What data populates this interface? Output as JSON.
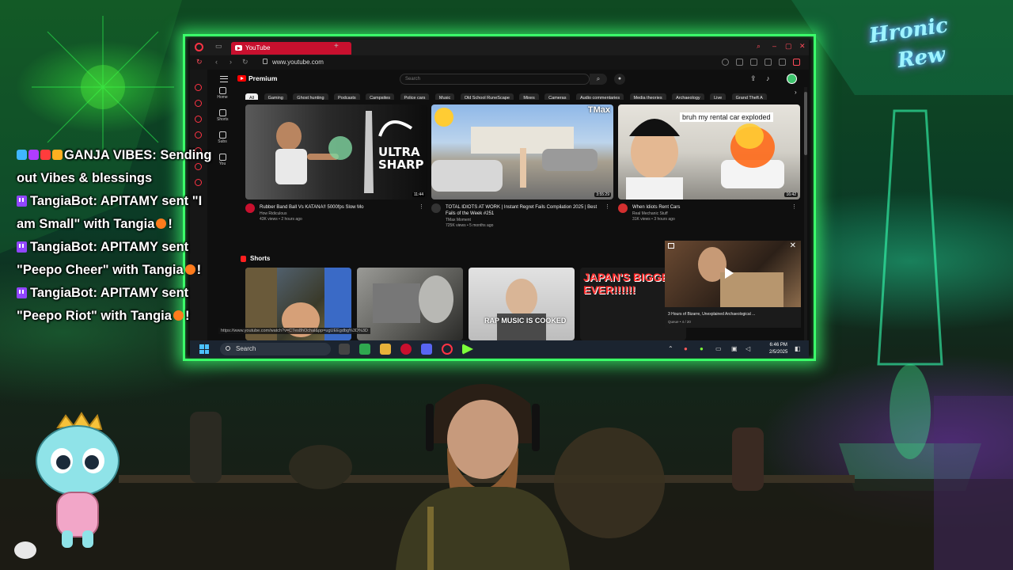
{
  "browser": {
    "tab_title": "YouTube",
    "url": "www.youtube.com"
  },
  "youtube": {
    "brand": "Premium",
    "search_placeholder": "Search",
    "chips": [
      "All",
      "Gaming",
      "Ghost hunting",
      "Podcasts",
      "Campsites",
      "Police cars",
      "Music",
      "Old School RuneScape",
      "Mixes",
      "Cameras",
      "Audio commentaries",
      "Media theories",
      "Archaeology",
      "Live",
      "Grand Theft A"
    ],
    "side": [
      "Home",
      "Shorts",
      "Subs",
      "You"
    ],
    "videos": [
      {
        "title": "Rubber Band Ball Vs KATANA!! 5000fps Slow Mo",
        "channel": "How Ridiculous",
        "stats": "43K views • 2 hours ago",
        "duration": "11:44",
        "thumb_text": "ULTRA SHARP"
      },
      {
        "title": "TOTAL IDIOTS AT WORK | Instant Regret Fails Compilation 2025 | Best Fails of the Week #251",
        "channel": "TMax Moment",
        "stats": "725K views • 5 months ago",
        "duration": "3:55:29",
        "thumb_text": "TMax"
      },
      {
        "title": "When Idiots Rent Cars",
        "channel": "Real Mechanic Stuff",
        "stats": "31K views • 3 hours ago",
        "duration": "16:42",
        "thumb_text": "bruh my rental car exploded"
      }
    ],
    "shorts_label": "Shorts",
    "shorts": [
      {
        "caption": ""
      },
      {
        "caption": ""
      },
      {
        "caption": "RAP MUSIC IS COOKED"
      },
      {
        "caption": "JAPAN'S BIGGEST EVER!!!!!!"
      }
    ],
    "miniplayer": {
      "title": "3 Hours of Bizarre, Unexplained Archaeological ...",
      "sub": "Queue • 4 / 20"
    },
    "status_url": "https://www.youtube.com/watch?v=C7es8hOchal&pp=ugUEEgdbg%3D%3D"
  },
  "taskbar": {
    "search": "Search",
    "time": "6:46 PM",
    "date": "2/5/2025"
  },
  "chat": {
    "lines": [
      {
        "user": "GANJA VIBES",
        "text": ": Sending",
        "type": "first"
      },
      {
        "user": "",
        "text": "out Vibes & blessings",
        "type": "cont"
      },
      {
        "user": "TangiaBot",
        "text": ": APITAMY sent \"I",
        "type": "first"
      },
      {
        "user": "",
        "text": "am Small\" with Tangia",
        "type": "tail"
      },
      {
        "user": "TangiaBot",
        "text": ": APITAMY sent",
        "type": "first"
      },
      {
        "user": "",
        "text": "\"Peepo Cheer\" with Tangia",
        "type": "tail"
      },
      {
        "user": "TangiaBot",
        "text": ": APITAMY sent",
        "type": "first"
      },
      {
        "user": "",
        "text": "\"Peepo Riot\" with Tangia",
        "type": "tail"
      }
    ],
    "exclaim": "!"
  },
  "overlay": {
    "logo_line1": "Hronic",
    "logo_line2": "Rew"
  },
  "colors": {
    "monitor_glow": "#3bff6a",
    "youtube_red": "#ff0000",
    "tab_red": "#c8102e",
    "twitch_purple": "#9146ff"
  }
}
